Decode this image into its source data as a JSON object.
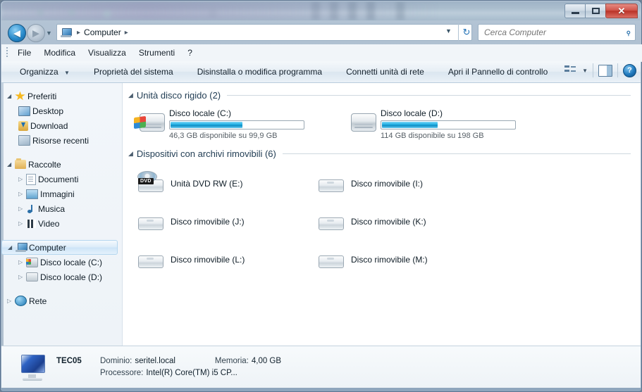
{
  "window": {
    "controls": {
      "minimize": "−",
      "maximize": "□",
      "close": "✕"
    }
  },
  "address": {
    "back_label": "◀",
    "forward_label": "▶",
    "history_caret": "▼",
    "icon": "computer-icon",
    "path_root": "Computer",
    "sep": "▸",
    "dropdown_caret": "▼",
    "refresh_label": "↻"
  },
  "search": {
    "placeholder": "Cerca Computer",
    "value": "",
    "icon": "search-icon"
  },
  "menu": {
    "items": [
      {
        "label": "File"
      },
      {
        "label": "Modifica"
      },
      {
        "label": "Visualizza"
      },
      {
        "label": "Strumenti"
      },
      {
        "label": "?"
      }
    ]
  },
  "toolbar": {
    "organize": "Organizza",
    "organize_caret": "▼",
    "system_properties": "Proprietà del sistema",
    "uninstall": "Disinstalla o modifica programma",
    "map_drive": "Connetti unità di rete",
    "control_panel": "Apri il Pannello di controllo",
    "view_caret": "▼",
    "help_label": "?"
  },
  "sidebar": {
    "groups": [
      {
        "label": "Preferiti",
        "icon": "star-icon",
        "expander": "◢",
        "children": [
          {
            "label": "Desktop",
            "icon": "desktop-icon",
            "expander": ""
          },
          {
            "label": "Download",
            "icon": "download-icon",
            "expander": ""
          },
          {
            "label": "Risorse recenti",
            "icon": "recent-places-icon",
            "expander": ""
          }
        ]
      },
      {
        "label": "Raccolte",
        "icon": "library-icon",
        "expander": "◢",
        "children": [
          {
            "label": "Documenti",
            "icon": "documents-icon",
            "expander": "▷"
          },
          {
            "label": "Immagini",
            "icon": "pictures-icon",
            "expander": "▷"
          },
          {
            "label": "Musica",
            "icon": "music-icon",
            "expander": "▷"
          },
          {
            "label": "Video",
            "icon": "video-icon",
            "expander": "▷"
          }
        ]
      },
      {
        "label": "Computer",
        "icon": "computer-icon",
        "expander": "◢",
        "selected": true,
        "children": [
          {
            "label": "Disco locale (C:)",
            "icon": "hard-drive-system-icon",
            "expander": "▷"
          },
          {
            "label": "Disco locale (D:)",
            "icon": "hard-drive-icon",
            "expander": "▷"
          }
        ]
      },
      {
        "label": "Rete",
        "icon": "network-icon",
        "expander": "▷",
        "children": []
      }
    ]
  },
  "main": {
    "groups": [
      {
        "title": "Unità disco rigido (2)",
        "expander": "◢"
      },
      {
        "title": "Dispositivi con archivi rimovibili (6)",
        "expander": "◢"
      }
    ],
    "hard_drives": [
      {
        "name": "Disco locale (C:)",
        "free_text": "46,3 GB disponibile su 99,9 GB",
        "used_percent": 54,
        "icon": "hard-drive-system-icon"
      },
      {
        "name": "Disco locale (D:)",
        "free_text": "114 GB disponibile su 198 GB",
        "used_percent": 42,
        "icon": "hard-drive-icon"
      }
    ],
    "removable": [
      {
        "name": "Unità DVD RW (E:)",
        "icon": "dvd-drive-icon",
        "badge": "DVD"
      },
      {
        "name": "Disco rimovibile (I:)",
        "icon": "removable-disk-icon"
      },
      {
        "name": "Disco rimovibile (J:)",
        "icon": "removable-disk-icon"
      },
      {
        "name": "Disco rimovibile (K:)",
        "icon": "removable-disk-icon"
      },
      {
        "name": "Disco rimovibile (L:)",
        "icon": "removable-disk-icon"
      },
      {
        "name": "Disco rimovibile (M:)",
        "icon": "removable-disk-icon"
      }
    ]
  },
  "status": {
    "computer_name": "TEC05",
    "domain_label": "Dominio:",
    "domain_value": "seritel.local",
    "memory_label": "Memoria:",
    "memory_value": "4,00 GB",
    "processor_label": "Processore:",
    "processor_value": "Intel(R) Core(TM) i5 CP...",
    "icon": "computer-status-icon"
  },
  "colors": {
    "accent": "#29b5e8",
    "close": "#b93328",
    "selection": "#cde4f7"
  }
}
